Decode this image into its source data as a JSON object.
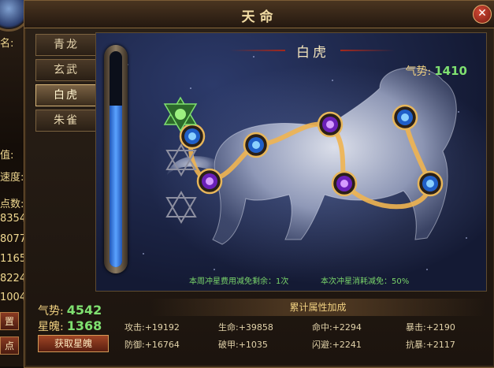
{
  "window": {
    "title": "天命"
  },
  "tabs": [
    {
      "label": "青龙",
      "active": false
    },
    {
      "label": "玄武",
      "active": false
    },
    {
      "label": "白虎",
      "active": true
    },
    {
      "label": "朱雀",
      "active": false
    }
  ],
  "stage": {
    "title": "白虎",
    "power_label": "气势:",
    "power_value": "1410",
    "note_left": "本周冲星费用减免剩余：1次",
    "note_right": "本次冲星消耗减免：50%"
  },
  "gauge": {
    "fill_fraction": 0.75,
    "color": "#3c7ee8"
  },
  "constellation": {
    "star_count": 8,
    "line_color": "#f0b450",
    "star_colors": [
      "blue",
      "purple",
      "blue",
      "purple",
      "purple",
      "blue",
      "blue",
      "blue"
    ]
  },
  "summary": {
    "qishi_label": "气势:",
    "qishi_value": "4542",
    "xingpo_label": "星魄:",
    "xingpo_value": "1368",
    "get_button": "获取星魄"
  },
  "stats": {
    "header": "累计属性加成",
    "items": [
      {
        "label": "攻击",
        "value": ":+19192"
      },
      {
        "label": "生命",
        "value": ":+39858"
      },
      {
        "label": "命中",
        "value": ":+2294"
      },
      {
        "label": "暴击",
        "value": ":+2190"
      },
      {
        "label": "防御",
        "value": ":+16764"
      },
      {
        "label": "破甲",
        "value": ":+1035"
      },
      {
        "label": "闪避",
        "value": ":+2241"
      },
      {
        "label": "抗暴",
        "value": ":+2117"
      }
    ]
  },
  "background": {
    "items": [
      "名:",
      "值:",
      "速度:",
      "点数:",
      "8354",
      "8077",
      "1165",
      "8224",
      "1004"
    ],
    "button_set": "置",
    "button_add": "点"
  }
}
